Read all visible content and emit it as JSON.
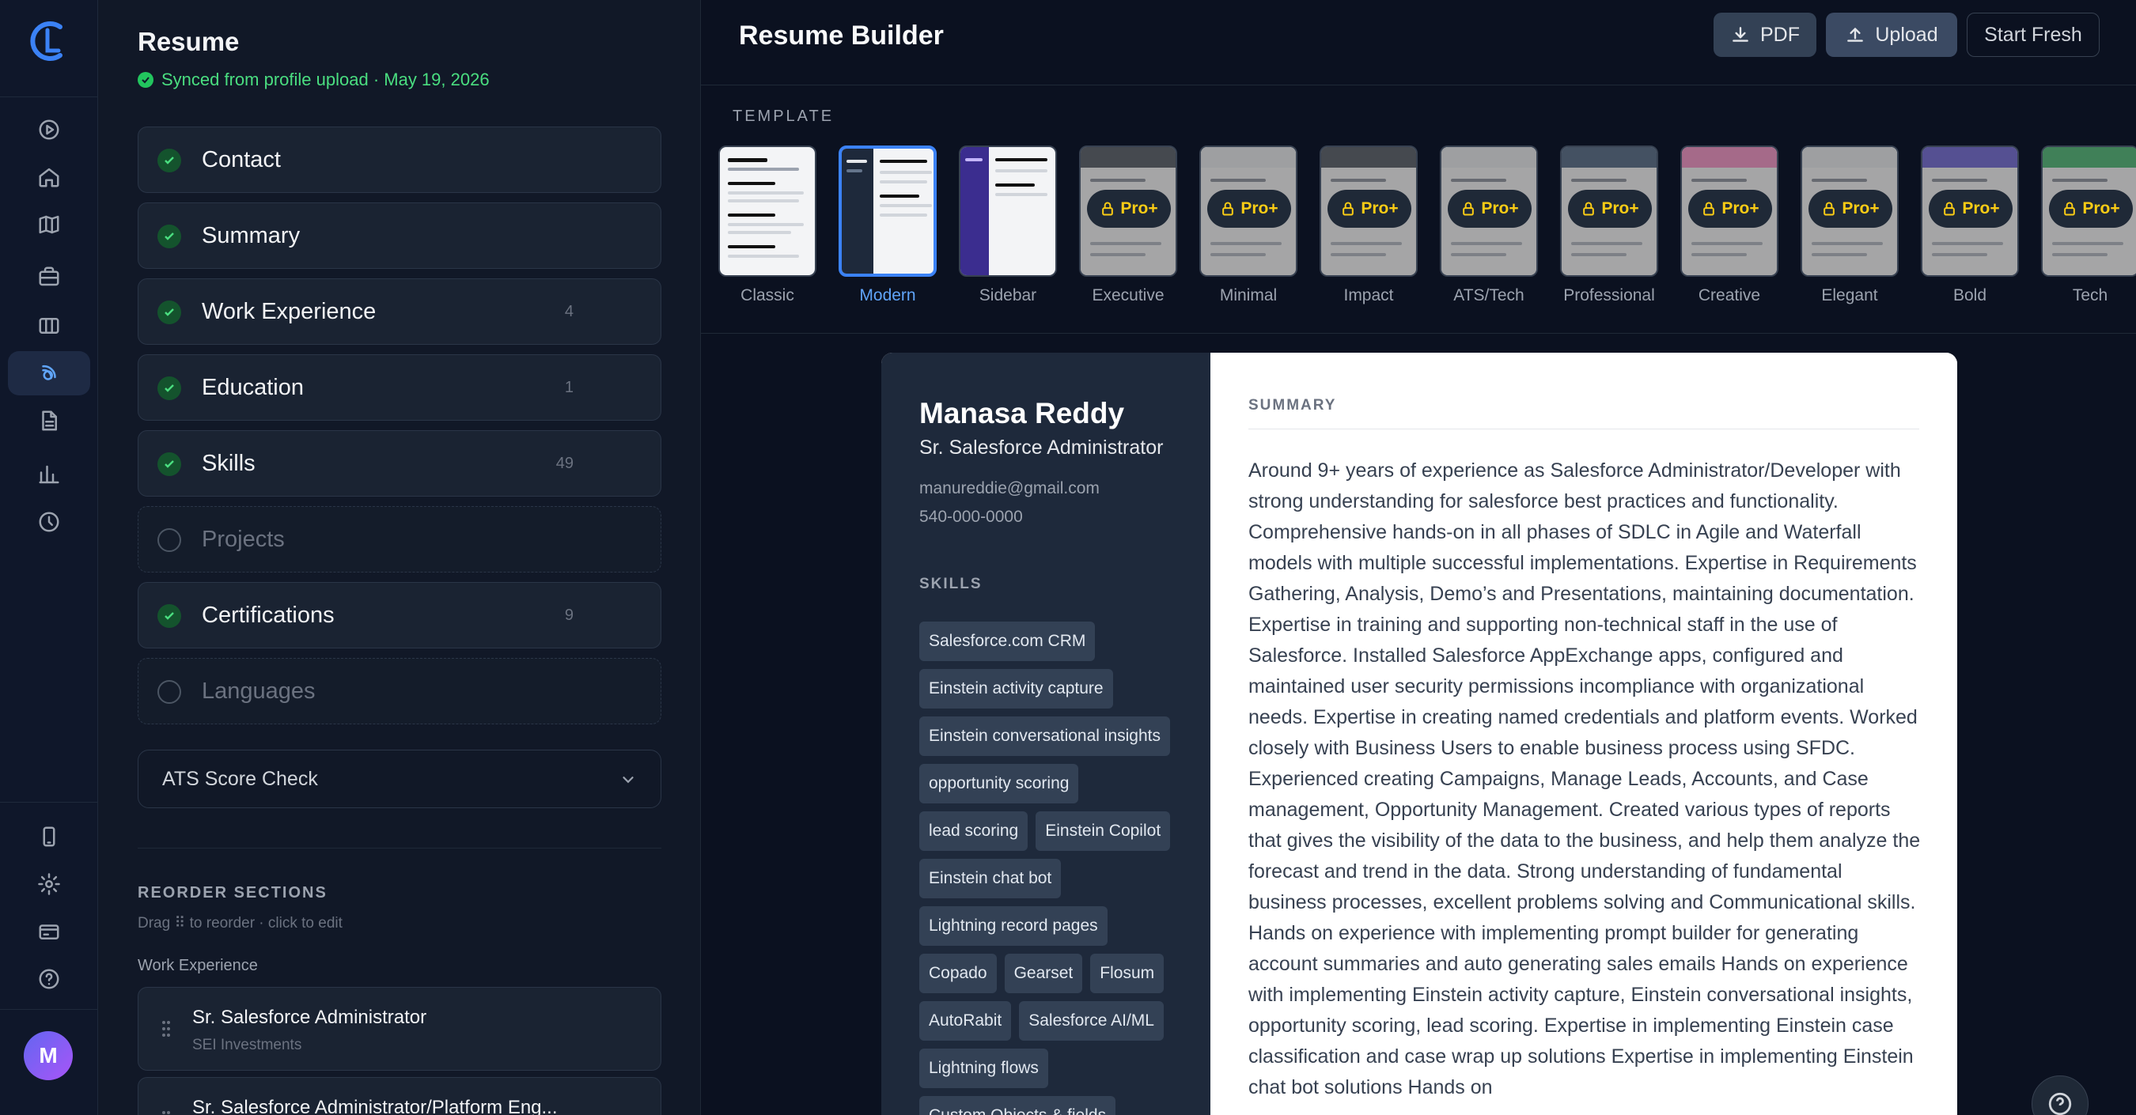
{
  "app": {
    "avatar_initial": "M"
  },
  "panel": {
    "title": "Resume",
    "sync_status": "Synced from profile upload · May 19, 2026",
    "sections": [
      {
        "label": "Contact",
        "count": "",
        "done": true
      },
      {
        "label": "Summary",
        "count": "",
        "done": true
      },
      {
        "label": "Work Experience",
        "count": "4",
        "done": true
      },
      {
        "label": "Education",
        "count": "1",
        "done": true
      },
      {
        "label": "Skills",
        "count": "49",
        "done": true
      },
      {
        "label": "Projects",
        "count": "",
        "done": false
      },
      {
        "label": "Certifications",
        "count": "9",
        "done": true
      },
      {
        "label": "Languages",
        "count": "",
        "done": false
      }
    ],
    "ats_label": "ATS Score Check",
    "reorder_title": "REORDER SECTIONS",
    "reorder_hint": "Drag ⠿ to reorder · click to edit",
    "reorder_group": "Work Experience",
    "reorder_items": [
      {
        "title": "Sr. Salesforce Administrator",
        "sub": "SEI Investments"
      },
      {
        "title": "Sr. Salesforce Administrator/Platform Eng...",
        "sub": ""
      }
    ]
  },
  "toolbar": {
    "title": "Resume Builder",
    "pdf_label": "PDF",
    "upload_label": "Upload",
    "fresh_label": "Start Fresh"
  },
  "templates": {
    "caption": "TEMPLATE",
    "lock_label": "Pro+",
    "items": [
      {
        "name": "Classic",
        "locked": false
      },
      {
        "name": "Modern",
        "locked": false,
        "selected": true
      },
      {
        "name": "Sidebar",
        "locked": false
      },
      {
        "name": "Executive",
        "locked": true
      },
      {
        "name": "Minimal",
        "locked": true
      },
      {
        "name": "Impact",
        "locked": true
      },
      {
        "name": "ATS/Tech",
        "locked": true
      },
      {
        "name": "Professional",
        "locked": true
      },
      {
        "name": "Creative",
        "locked": true
      },
      {
        "name": "Elegant",
        "locked": true
      },
      {
        "name": "Bold",
        "locked": true
      },
      {
        "name": "Tech",
        "locked": true
      }
    ]
  },
  "preview": {
    "name": "Manasa Reddy",
    "role": "Sr. Salesforce Administrator",
    "email": "manureddie@gmail.com",
    "phone": "540-000-0000",
    "skills_heading": "SKILLS",
    "skills": [
      "Salesforce.com CRM",
      "Einstein activity capture",
      "Einstein conversational insights",
      "opportunity scoring",
      "lead scoring",
      "Einstein Copilot",
      "Einstein chat bot",
      "Lightning record pages",
      "Copado",
      "Gearset",
      "Flosum",
      "AutoRabit",
      "Salesforce AI/ML",
      "Lightning flows",
      "Custom Objects & fields"
    ],
    "summary_heading": "SUMMARY",
    "summary": "Around 9+ years of experience as Salesforce Administrator/Developer with strong understanding for salesforce best practices and functionality. Comprehensive hands-on in all phases of SDLC in Agile and Waterfall models with multiple successful implementations. Expertise in Requirements Gathering, Analysis, Demo’s and Presentations, maintaining documentation. Expertise in training and supporting non-technical staff in the use of Salesforce. Installed Salesforce AppExchange apps, configured and maintained user security permissions incompliance with organizational needs. Expertise in creating named credentials and platform events. Worked closely with Business Users to enable business process using SFDC. Experienced creating Campaigns, Manage Leads, Accounts, and Case management, Opportunity Management. Created various types of reports that gives the visibility of the data to the business, and help them analyze the forecast and trend in the data. Strong understanding of fundamental business processes, excellent problems solving and Communicational skills. Hands on experience with implementing prompt builder for generating account summaries and auto generating sales emails Hands on experience with implementing Einstein activity capture, Einstein conversational insights, opportunity scoring, lead scoring. Expertise in implementing Einstein case classification and case wrap up solutions Expertise in implementing Einstein chat bot solutions Hands on"
  }
}
